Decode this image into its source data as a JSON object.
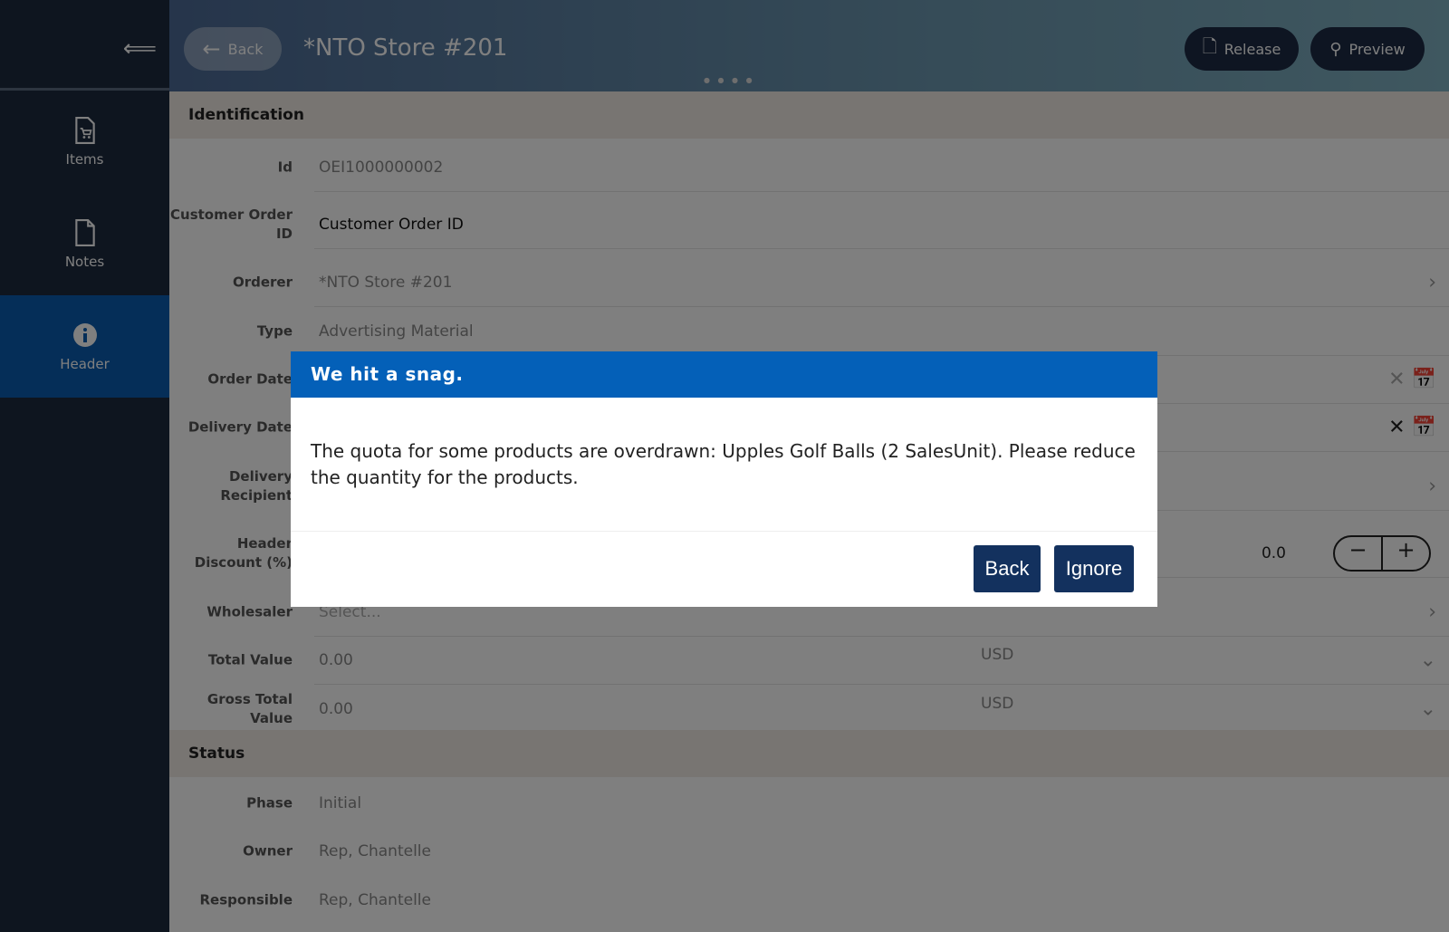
{
  "sidebar": {
    "items": [
      {
        "label": "Items",
        "icon": "cart-document-icon"
      },
      {
        "label": "Notes",
        "icon": "note-icon"
      },
      {
        "label": "Header",
        "icon": "info-icon",
        "active": true
      }
    ]
  },
  "header": {
    "back_label": "Back",
    "title": "*NTO Store #201",
    "release_label": "Release",
    "preview_label": "Preview"
  },
  "identification": {
    "title": "Identification",
    "fields": [
      {
        "label": "Id",
        "value": "OEI1000000002"
      },
      {
        "label": "Customer Order ID",
        "value": "Customer Order ID"
      },
      {
        "label": "Orderer",
        "value": "*NTO Store #201"
      },
      {
        "label": "Type",
        "value": "Advertising Material"
      },
      {
        "label": "Order Date",
        "value": ""
      },
      {
        "label": "Delivery Date",
        "value": ""
      },
      {
        "label": "Delivery Recipient",
        "value": ""
      },
      {
        "label": "Header Discount (%)",
        "value": "0.0"
      },
      {
        "label": "Wholesaler",
        "placeholder": "Select..."
      },
      {
        "label": "Total Value",
        "value": "0.00",
        "currency": "USD"
      },
      {
        "label": "Gross Total Value",
        "value": "0.00",
        "currency": "USD"
      }
    ]
  },
  "status": {
    "title": "Status",
    "fields": [
      {
        "label": "Phase",
        "value": "Initial"
      },
      {
        "label": "Owner",
        "value": "Rep, Chantelle"
      },
      {
        "label": "Responsible",
        "value": "Rep, Chantelle"
      }
    ]
  },
  "dialog": {
    "title": "We hit a snag.",
    "message": "The quota for some products are overdrawn: Upples Golf Balls (2 SalesUnit). Please reduce the quantity for the products.",
    "back_label": "Back",
    "ignore_label": "Ignore"
  },
  "colors": {
    "dialog_header": "#0460b8",
    "dialog_button": "#13315e",
    "sidebar_active": "#0b5cb0"
  }
}
